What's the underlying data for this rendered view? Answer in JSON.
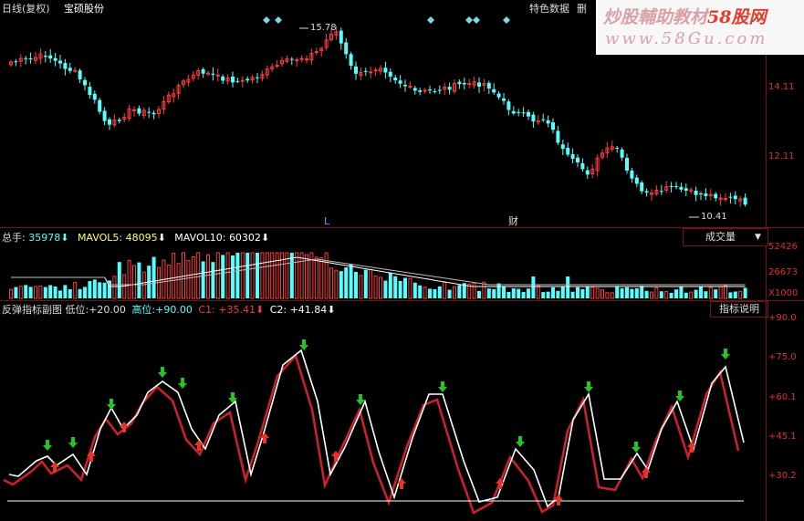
{
  "header": {
    "period_label": "日线(复权)",
    "stock_name": "宝硕股份",
    "feature_data_label": "特色数据",
    "delete_label": "删"
  },
  "watermark": {
    "title_prefix": "炒股輔助教材",
    "title_site": "58股网",
    "url": "www.58Gu.com"
  },
  "price_pane": {
    "high_label": "15.78",
    "low_label": "10.41",
    "y_axis_labels": [
      "14.11",
      "12.11"
    ],
    "markers": [
      "L",
      "财"
    ]
  },
  "volume_pane": {
    "legend": {
      "total_label": "总手:",
      "total_value": "35978",
      "mavol5_label": "MAVOL5:",
      "mavol5_value": "48095",
      "mavol10_label": "MAVOL10:",
      "mavol10_value": "60302"
    },
    "dropdown_label": "成交量",
    "y_axis_labels": [
      "52426",
      "26673",
      "X1000"
    ]
  },
  "indicator_pane": {
    "title": "反弹指标副图",
    "low_label": "低位:",
    "low_value": "+20.00",
    "high_label": "高位:",
    "high_value": "+90.00",
    "c1_label": "C1:",
    "c1_value": "+35.41",
    "c2_label": "C2:",
    "c2_value": "+41.84",
    "explain_button": "指标说明",
    "y_axis_labels": [
      "+90.0",
      "+75.0",
      "+60.1",
      "+45.1",
      "+30.2"
    ]
  },
  "colors": {
    "up": "#ff3b3b",
    "down": "#54ffff",
    "ma_white": "#ffffff",
    "ma_yellow": "#ffff00",
    "axis_red": "#e0302c",
    "arrow_green": "#23c423",
    "arrow_red": "#e8332a"
  }
}
